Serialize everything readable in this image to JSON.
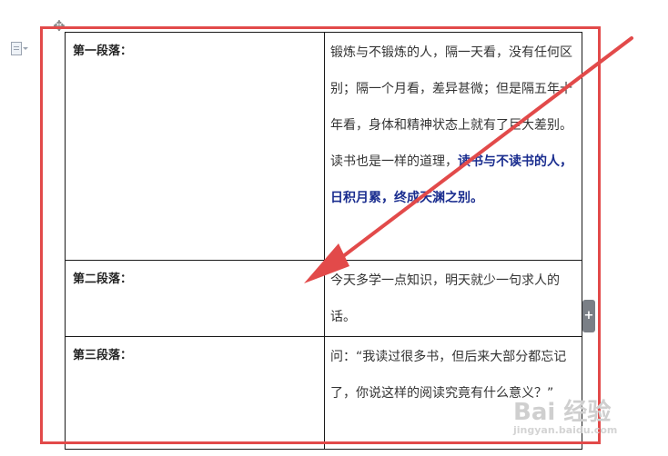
{
  "icons": {
    "move_handle": "move-icon",
    "document": "document-icon",
    "add_row": "plus-icon"
  },
  "colors": {
    "annotation_red": "#e24a4a",
    "emphasis_blue": "#1a2d8f"
  },
  "table": {
    "rows": [
      {
        "label": "第一段落：",
        "text_plain": "锻炼与不锻炼的人，隔一天看，没有任何区别；隔一个月看，差异甚微；但是隔五年十年看，身体和精神状态上就有了巨大差别。读书也是一样的道理，",
        "text_emphasis": "读书与不读书的人，日积月累，终成天渊之别。"
      },
      {
        "label": "第二段落：",
        "text_plain": "今天多学一点知识，明天就少一句求人的话。",
        "text_emphasis": ""
      },
      {
        "label": "第三段落：",
        "text_plain": "问：“我读过很多书，但后来大部分都忘记了，你说这样的阅读究竟有什么意义？”",
        "text_emphasis": ""
      }
    ]
  },
  "add_button_label": "+",
  "watermark": {
    "main": "Bai 经验",
    "sub": "jingyan.baidu.com"
  }
}
